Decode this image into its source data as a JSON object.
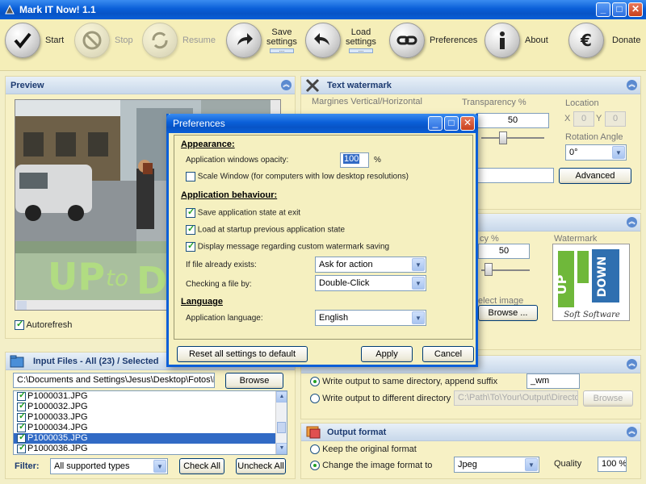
{
  "window": {
    "title": "Mark IT Now! 1.1"
  },
  "toolbar": {
    "start": "Start",
    "stop": "Stop",
    "resume": "Resume",
    "save_settings": [
      "Save",
      "settings"
    ],
    "load_settings": [
      "Load",
      "settings"
    ],
    "dots": "....",
    "preferences": "Preferences",
    "about": "About",
    "donate": "Donate"
  },
  "preview": {
    "title": "Preview",
    "autorefresh": "Autorefresh"
  },
  "text_watermark": {
    "title": "Text watermark",
    "margins_label": "Margines Vertical/Horizontal",
    "transparency_label": "Transparency %",
    "transparency_value": "50",
    "location_label": "Location",
    "x_label": "X",
    "x_value": "0",
    "y_label": "Y",
    "y_value": "0",
    "rotation_label": "Rotation Angle",
    "rotation_value": "0°",
    "advanced_button": "Advanced"
  },
  "image_watermark": {
    "transparency_label": "cy %",
    "transparency_value": "50",
    "select_image_label": "elect image",
    "browse_button": "Browse ...",
    "watermark_label": "Watermark"
  },
  "input_files": {
    "title": "Input Files - All (23) / Selected",
    "path_value": "C:\\Documents and Settings\\Jesus\\Desktop\\Fotos\\Nueva c",
    "browse_button": "Browse",
    "files": [
      "P1000031.JPG",
      "P1000032.JPG",
      "P1000033.JPG",
      "P1000034.JPG",
      "P1000035.JPG",
      "P1000036.JPG"
    ],
    "filter_label": "Filter:",
    "filter_value": "All supported types",
    "check_all": "Check All",
    "uncheck_all": "Uncheck All"
  },
  "output": {
    "same_dir_label": "Write output to same directory, append suffix",
    "suffix_value": "_wm",
    "diff_dir_label": "Write output to different directory",
    "dir_placeholder": "C:\\Path\\To\\Your\\Output\\Directory",
    "browse_button": "Browse"
  },
  "output_format": {
    "title": "Output format",
    "keep_label": "Keep the original format",
    "change_label": "Change the image format to",
    "format_value": "Jpeg",
    "quality_label": "Quality",
    "quality_value": "100 %"
  },
  "preferences": {
    "title": "Preferences",
    "appearance_heading": "Appearance:",
    "opacity_label": "Application windows opacity:",
    "opacity_value": "100",
    "opacity_unit": "%",
    "scale_window": "Scale Window (for computers  with low desktop resolutions)",
    "behaviour_heading": "Application behaviour:",
    "save_state": "Save application state at exit",
    "load_state": "Load at startup previous application state",
    "display_message": "Display message regarding custom watermark saving",
    "file_exists_label": "If file already exists:",
    "file_exists_value": "Ask for action",
    "checking_label": "Checking a file by:",
    "checking_value": "Double-Click",
    "language_heading": "Language",
    "app_language_label": "Application language:",
    "app_language_value": "English",
    "reset_button": "Reset all settings to default",
    "apply_button": "Apply",
    "cancel_button": "Cancel"
  }
}
